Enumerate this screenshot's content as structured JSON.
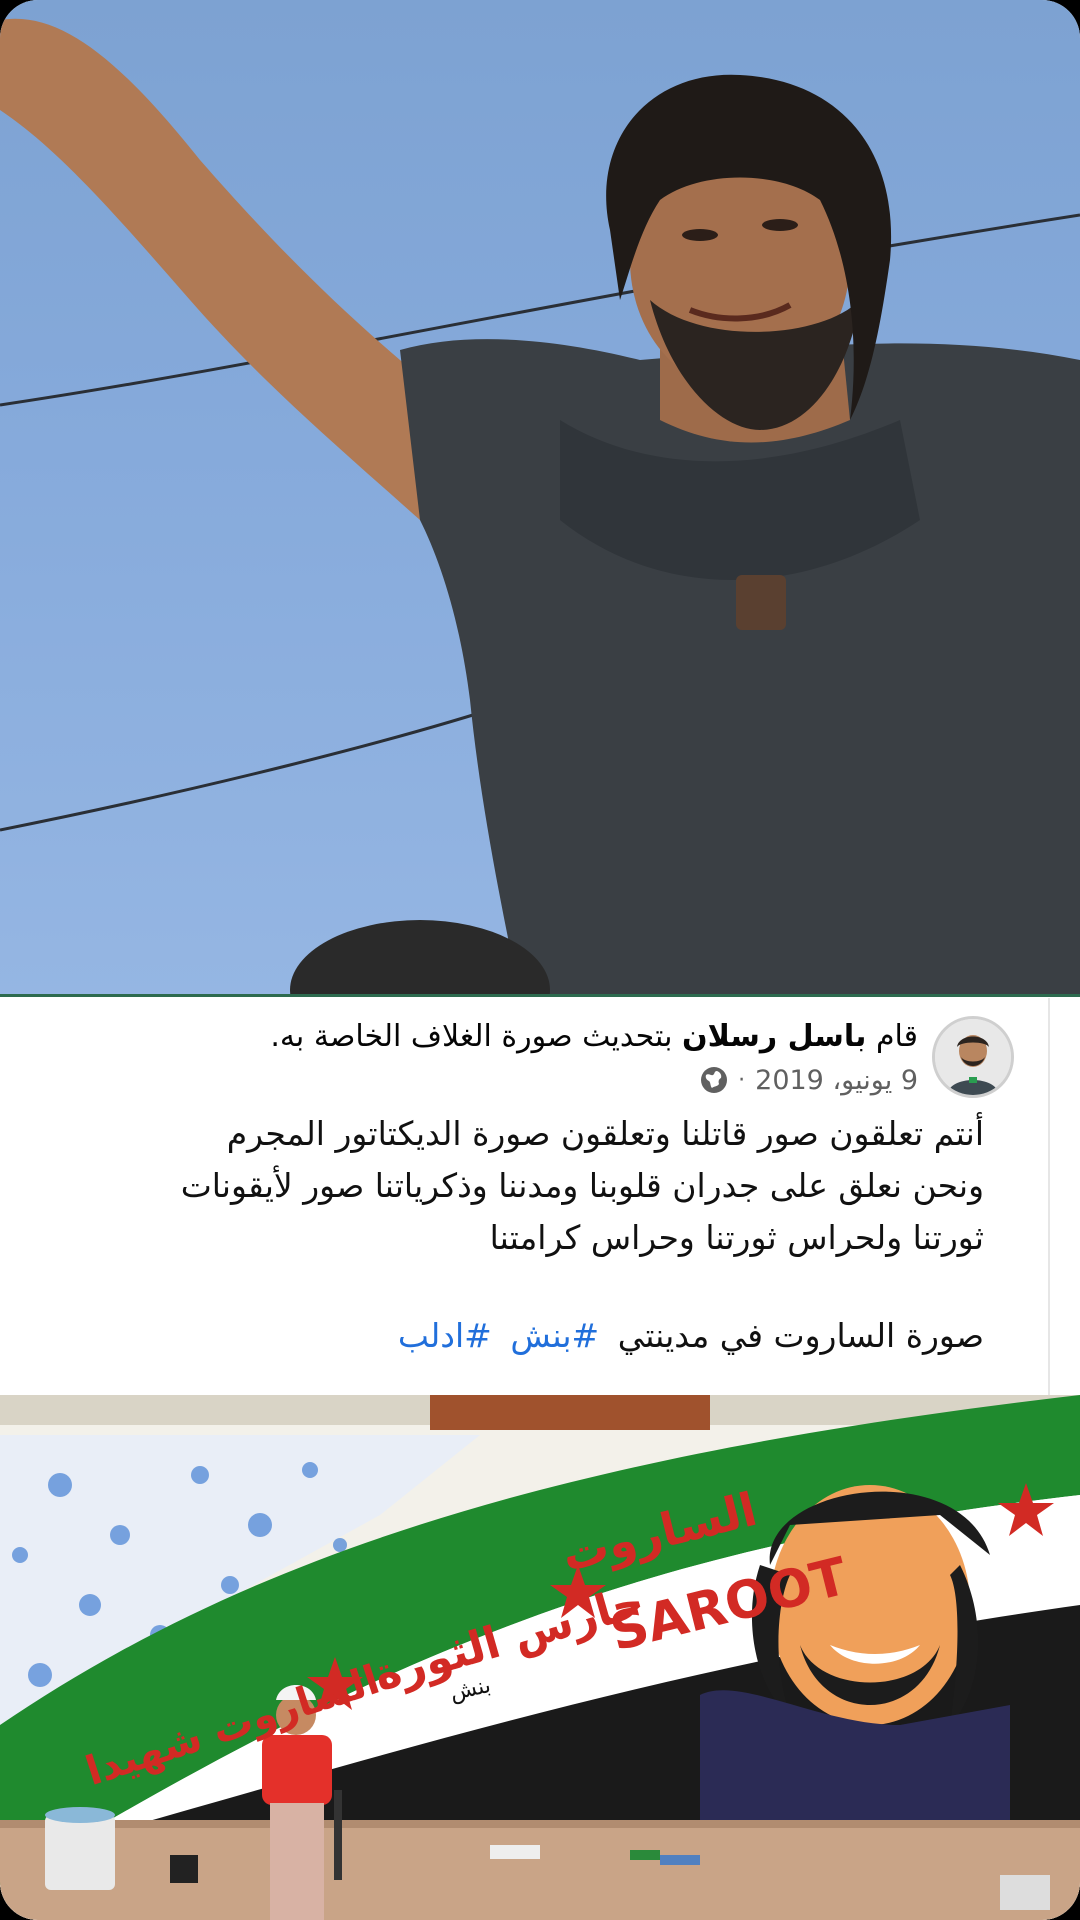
{
  "post": {
    "author": "باسل رسلان",
    "action_prefix": "قام",
    "action_suffix": "بتحديث صورة الغلاف الخاصة به.",
    "date": "9 يونيو، 2019",
    "separator": "·",
    "privacy_icon": "globe-icon",
    "body": "أنتم تعلقون صور قاتلنا وتعلقون صورة الديكتاتور المجرم\nونحن نعلق على جدران قلوبنا ومدننا وذكرياتنا صور لأيقونات\nثورتنا ولحراس ثورتنا وحراس كرامتنا",
    "tags_text": "صورة الساروت في مدينتي",
    "hashtags": [
      "#بنش",
      "#ادلب"
    ]
  },
  "mural": {
    "sarout_arabic": "الساروت",
    "sarout_latin": "SAROOT",
    "guardian": "حارس الثورة",
    "martyr": "الساروت شهيدا",
    "signature": "بنش"
  },
  "colors": {
    "link": "#216fdb",
    "text": "#050505",
    "meta": "#606060",
    "flag_green": "#1f8a2e",
    "flag_black": "#1a1a1a",
    "star_red": "#d22a24"
  }
}
